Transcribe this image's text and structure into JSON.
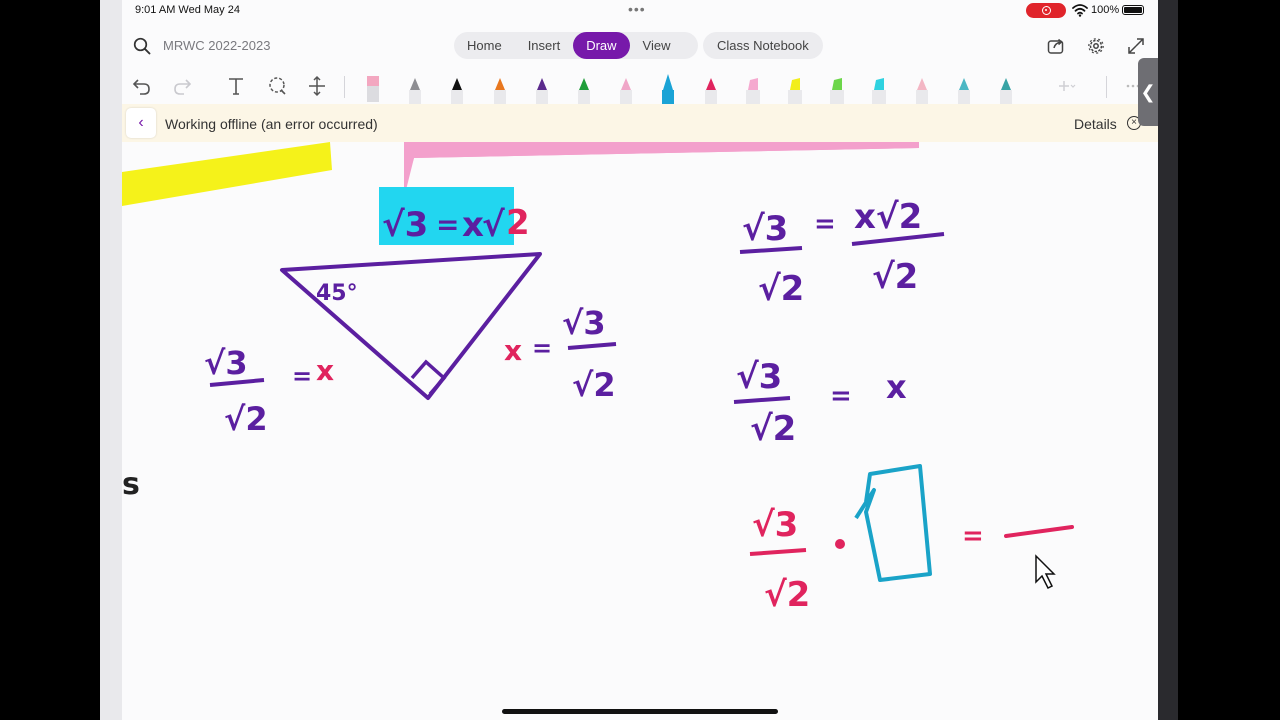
{
  "status_bar": {
    "time": "9:01 AM  Wed May 24",
    "battery": "100%"
  },
  "header": {
    "notebook_title": "MRWC 2022-2023",
    "tabs": [
      {
        "label": "Home"
      },
      {
        "label": "Insert"
      },
      {
        "label": "Draw",
        "active": true
      },
      {
        "label": "View"
      }
    ],
    "class_notebook": "Class Notebook"
  },
  "toolbar": {
    "tools": [
      "undo-icon",
      "redo-icon",
      "text-tool-icon",
      "lasso-select-icon",
      "insert-space-icon"
    ],
    "pens": [
      {
        "kind": "eraser",
        "color": "#f3a7c0"
      },
      {
        "kind": "pencil",
        "color": "#8e8e93"
      },
      {
        "kind": "pen",
        "color": "#111111"
      },
      {
        "kind": "pen",
        "color": "#e8771f"
      },
      {
        "kind": "pen",
        "color": "#5b2a8c"
      },
      {
        "kind": "pen",
        "color": "#1f9e3a"
      },
      {
        "kind": "pen",
        "color": "#f0a6c8"
      },
      {
        "kind": "pen",
        "color": "#1aa3d6",
        "selected": true
      },
      {
        "kind": "pen",
        "color": "#e0245e"
      },
      {
        "kind": "highlighter",
        "color": "#f5a9cf"
      },
      {
        "kind": "highlighter",
        "color": "#f2ee1a"
      },
      {
        "kind": "highlighter",
        "color": "#6cd64a"
      },
      {
        "kind": "highlighter",
        "color": "#2fd2e0"
      },
      {
        "kind": "pen",
        "color": "#f3b6c4"
      },
      {
        "kind": "pen",
        "color": "#4bb7c4"
      },
      {
        "kind": "pen",
        "color": "#38a3a5"
      }
    ]
  },
  "offline_banner": {
    "message": "Working offline (an error occurred)",
    "details": "Details"
  },
  "colors": {
    "accent": "#7719aa",
    "ink_purple": "#5b1fa0",
    "ink_pink": "#e0245e",
    "ink_cyan": "#1aa3c8",
    "highlight_cyan": "#22d6f0",
    "highlight_yellow": "#f5f21a",
    "highlight_pink": "#f3a0cc"
  },
  "ink_notes": {
    "top_equation": {
      "a": "√3",
      "eq": "=",
      "x": "x",
      "b": "√",
      "c": "2"
    },
    "angle_label": "45°",
    "left_fraction": {
      "num": "√3",
      "den": "√2",
      "eq": "=",
      "var": "x"
    },
    "right_of_triangle": {
      "var": "x",
      "eq": "=",
      "num": "√3",
      "den": "√2"
    },
    "step1": {
      "num1": "√3",
      "den1": "√2",
      "eq": "=",
      "num2": "x√2",
      "den2": "√2"
    },
    "step2": {
      "num": "√3",
      "den": "√2",
      "eq": "=",
      "var": "x"
    },
    "step3": {
      "num": "√3",
      "den": "√2",
      "dot": "·",
      "eq": "="
    },
    "edge_text": "s"
  }
}
